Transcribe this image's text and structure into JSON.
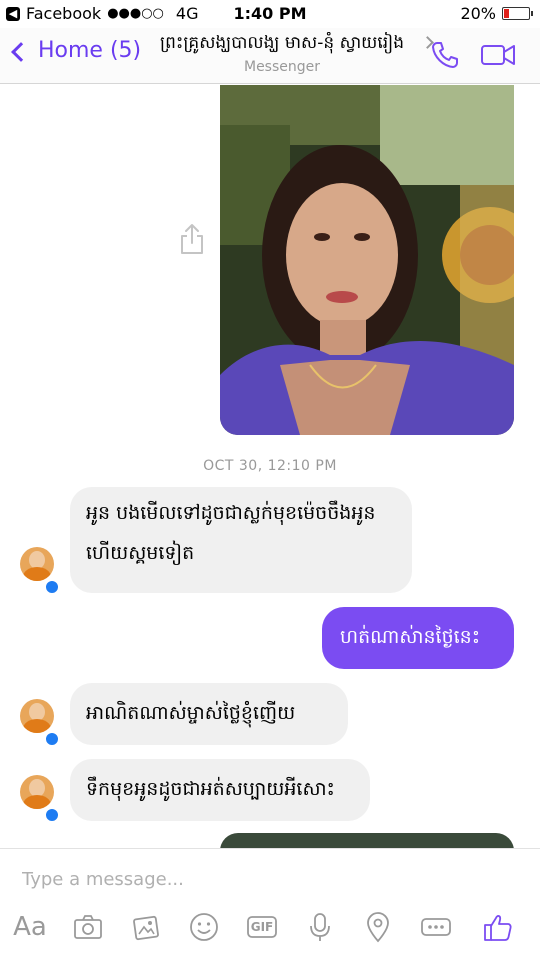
{
  "status_bar": {
    "back_app": "Facebook",
    "signal": "●●●○○",
    "network": "4G",
    "time": "1:40 PM",
    "battery_text": "20%",
    "battery_level": 0.2
  },
  "nav": {
    "back_label": "Home (5)",
    "title": "ព្រះគ្រូសង្ឃបាលង្ឃ មាស-នុំ ស្វាយរៀង",
    "subtitle": "Messenger"
  },
  "conversation": {
    "timestamp": "OCT 30, 12:10 PM",
    "messages": [
      {
        "direction": "in",
        "text_line1": "អូន បងមើលទៅដូចជាស្លក់មុខម៉េចចឹងអូន",
        "text_line2": "ហើយស្គមទៀត"
      },
      {
        "direction": "out",
        "text": "ហត់ណាស់ានថ្ងៃនេះ"
      },
      {
        "direction": "in",
        "text": "អាណិតណាស់ម្ចាស់ថ្លៃខ្ញុំញើយ"
      },
      {
        "direction": "in",
        "text": "ទឹកមុខអូនដូចជាអត់សប្បាយអីសោះ"
      }
    ]
  },
  "composer": {
    "placeholder": "Type a message...",
    "aa_label": "Aa",
    "gif_label": "GIF"
  },
  "colors": {
    "accent": "#7b4cf2",
    "incoming_bubble": "#f0f0f0",
    "icon_gray": "#9a9a9a",
    "messenger_blue": "#1e7cf2"
  }
}
